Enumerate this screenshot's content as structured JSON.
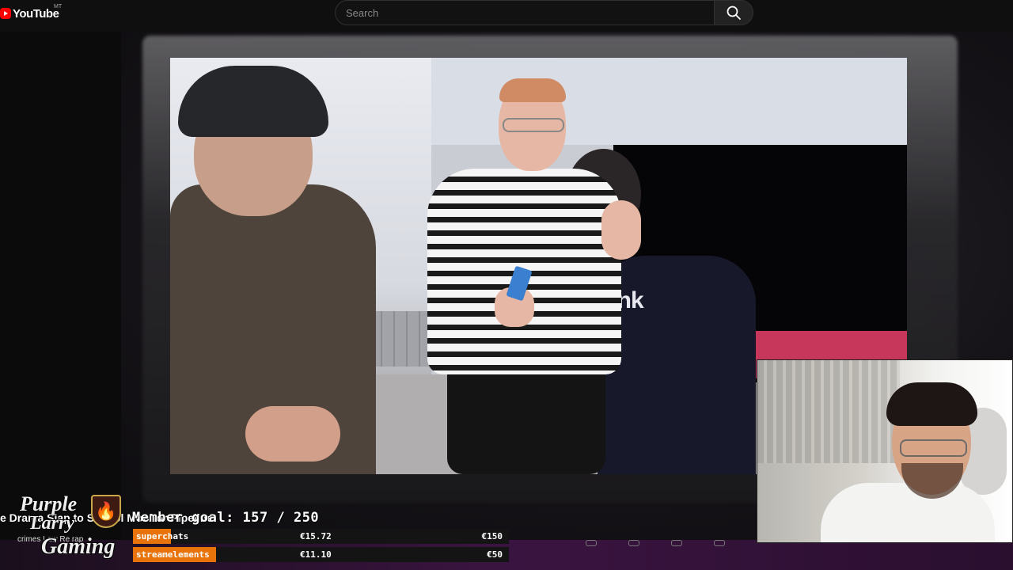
{
  "header": {
    "brand": "YouTube",
    "region": "MT",
    "search_placeholder": "Search"
  },
  "video": {
    "shirt_text": "hink"
  },
  "overlay": {
    "logo_line1": "Purple",
    "logo_line2": "Larry",
    "logo_line3": "Gaming",
    "ticker_text": "e Drama Slap to School Monitor Pipeline",
    "ticker_sub": "crimes Law Re rap",
    "member_goal_text": "Member goal: 157 / 250",
    "donations": [
      {
        "label": "superchats",
        "current": "€15.72",
        "goal": "€150",
        "progress": 0.1
      },
      {
        "label": "streamelements",
        "current": "€11.10",
        "goal": "€50",
        "progress": 0.22
      }
    ]
  },
  "colors": {
    "brand_red": "#ff0000",
    "progress_orange": "#e8730a"
  }
}
